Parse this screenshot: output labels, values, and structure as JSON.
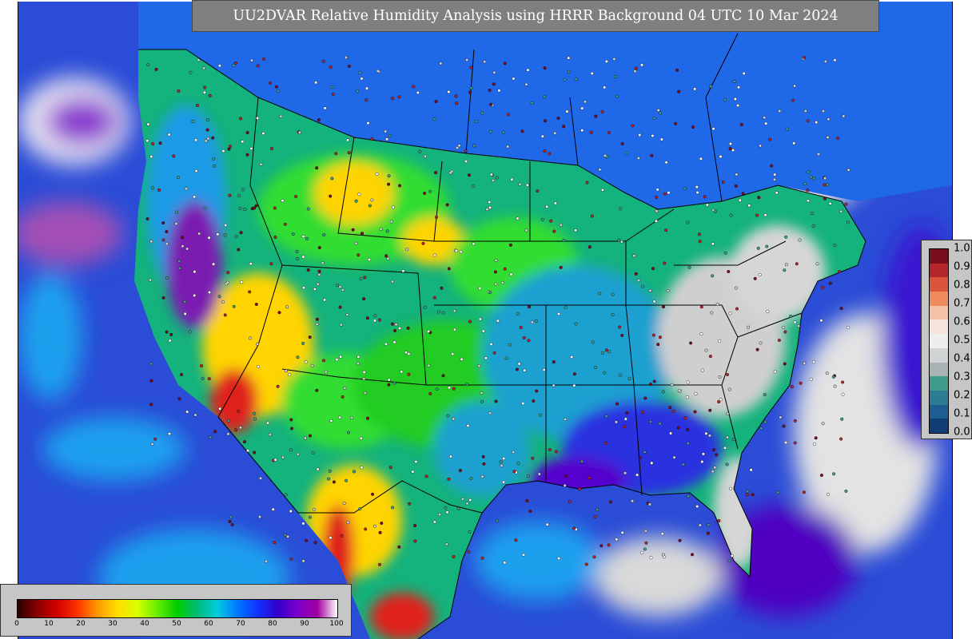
{
  "title": "UU2DVAR Relative Humidity Analysis using HRRR Background 04 UTC 10 Mar 2024",
  "rh_colorbar": {
    "ticks": [
      "0",
      "10",
      "20",
      "30",
      "40",
      "50",
      "60",
      "70",
      "80",
      "90",
      "100"
    ],
    "colors": [
      "#2a0000",
      "#8b0000",
      "#d40000",
      "#ff3300",
      "#ff9900",
      "#ffdd00",
      "#d8ff00",
      "#66ee00",
      "#00cc00",
      "#00bb77",
      "#00ccdd",
      "#0077ff",
      "#1133ff",
      "#3300cc",
      "#7a00cc",
      "#a000a0",
      "#ffffff"
    ]
  },
  "increment_colorbar": {
    "ticks": [
      "1.0",
      "0.9",
      "0.8",
      "0.7",
      "0.6",
      "0.5",
      "0.4",
      "0.3",
      "0.2",
      "0.1",
      "0.0"
    ],
    "colors": [
      "#7a0e1e",
      "#b5262a",
      "#d9543a",
      "#ef8b5f",
      "#f6c2a6",
      "#f4e4dc",
      "#eeeeee",
      "#cfd3d4",
      "#a7b3b4",
      "#3f9c8a",
      "#2d7c96",
      "#1e5d91",
      "#103e74"
    ]
  },
  "map_colors": {
    "ocean": "#2a4cd6",
    "land_base": "#14b27c",
    "dry": "#ffd400",
    "very_dry": "#e0201c",
    "green": "#22cc22",
    "moist": "#1a9ae6",
    "humid": "#5500cc",
    "saturated": "#d8d8d8",
    "border": "#000000"
  }
}
